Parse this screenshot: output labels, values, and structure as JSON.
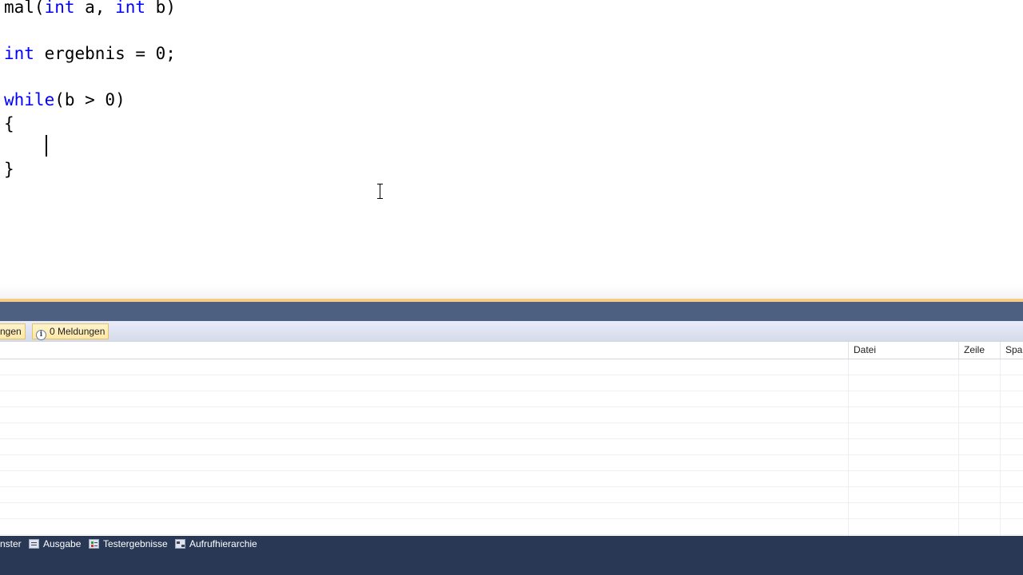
{
  "editor": {
    "lines": [
      {
        "parts": [
          "mal(",
          "int",
          " a, ",
          "int",
          " b)"
        ]
      },
      {
        "parts": [
          "",
          "int",
          " ergebnis = 0;"
        ]
      },
      {
        "parts": [
          "",
          "while",
          "(b > 0)"
        ]
      },
      {
        "parts": [
          "{"
        ]
      },
      {
        "parts": [
          "}"
        ]
      }
    ]
  },
  "error_list": {
    "filters": {
      "warnings_partial": "ngen",
      "messages": "0 Meldungen"
    },
    "columns": {
      "file": "Datei",
      "line": "Zeile",
      "column_partial": "Spal"
    }
  },
  "bottom_tabs": [
    {
      "label": "nster",
      "icon": "none"
    },
    {
      "label": "Ausgabe",
      "icon": "output-icon"
    },
    {
      "label": "Testergebnisse",
      "icon": "test-results-icon"
    },
    {
      "label": "Aufrufhierarchie",
      "icon": "call-hierarchy-icon"
    }
  ],
  "colors": {
    "keyword": "#0000ff",
    "text": "#000000",
    "tool_title": "#4d6082",
    "tab_strip": "#293955",
    "splitter": "#f5cc84"
  }
}
